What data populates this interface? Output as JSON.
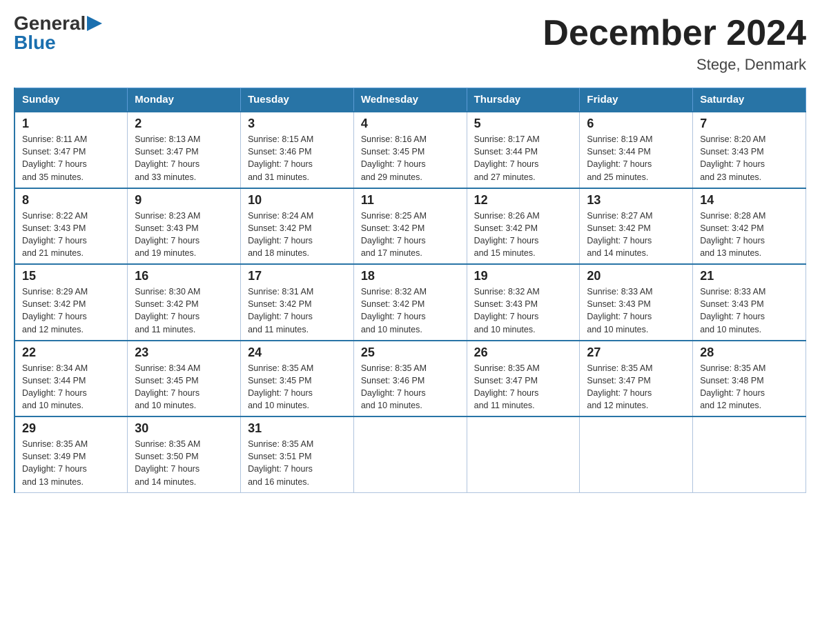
{
  "logo": {
    "general": "General",
    "blue": "Blue",
    "arrow": "▶"
  },
  "title": {
    "month": "December 2024",
    "location": "Stege, Denmark"
  },
  "days_of_week": [
    "Sunday",
    "Monday",
    "Tuesday",
    "Wednesday",
    "Thursday",
    "Friday",
    "Saturday"
  ],
  "weeks": [
    [
      {
        "day": "1",
        "sunrise": "8:11 AM",
        "sunset": "3:47 PM",
        "daylight": "7 hours and 35 minutes."
      },
      {
        "day": "2",
        "sunrise": "8:13 AM",
        "sunset": "3:47 PM",
        "daylight": "7 hours and 33 minutes."
      },
      {
        "day": "3",
        "sunrise": "8:15 AM",
        "sunset": "3:46 PM",
        "daylight": "7 hours and 31 minutes."
      },
      {
        "day": "4",
        "sunrise": "8:16 AM",
        "sunset": "3:45 PM",
        "daylight": "7 hours and 29 minutes."
      },
      {
        "day": "5",
        "sunrise": "8:17 AM",
        "sunset": "3:44 PM",
        "daylight": "7 hours and 27 minutes."
      },
      {
        "day": "6",
        "sunrise": "8:19 AM",
        "sunset": "3:44 PM",
        "daylight": "7 hours and 25 minutes."
      },
      {
        "day": "7",
        "sunrise": "8:20 AM",
        "sunset": "3:43 PM",
        "daylight": "7 hours and 23 minutes."
      }
    ],
    [
      {
        "day": "8",
        "sunrise": "8:22 AM",
        "sunset": "3:43 PM",
        "daylight": "7 hours and 21 minutes."
      },
      {
        "day": "9",
        "sunrise": "8:23 AM",
        "sunset": "3:43 PM",
        "daylight": "7 hours and 19 minutes."
      },
      {
        "day": "10",
        "sunrise": "8:24 AM",
        "sunset": "3:42 PM",
        "daylight": "7 hours and 18 minutes."
      },
      {
        "day": "11",
        "sunrise": "8:25 AM",
        "sunset": "3:42 PM",
        "daylight": "7 hours and 17 minutes."
      },
      {
        "day": "12",
        "sunrise": "8:26 AM",
        "sunset": "3:42 PM",
        "daylight": "7 hours and 15 minutes."
      },
      {
        "day": "13",
        "sunrise": "8:27 AM",
        "sunset": "3:42 PM",
        "daylight": "7 hours and 14 minutes."
      },
      {
        "day": "14",
        "sunrise": "8:28 AM",
        "sunset": "3:42 PM",
        "daylight": "7 hours and 13 minutes."
      }
    ],
    [
      {
        "day": "15",
        "sunrise": "8:29 AM",
        "sunset": "3:42 PM",
        "daylight": "7 hours and 12 minutes."
      },
      {
        "day": "16",
        "sunrise": "8:30 AM",
        "sunset": "3:42 PM",
        "daylight": "7 hours and 11 minutes."
      },
      {
        "day": "17",
        "sunrise": "8:31 AM",
        "sunset": "3:42 PM",
        "daylight": "7 hours and 11 minutes."
      },
      {
        "day": "18",
        "sunrise": "8:32 AM",
        "sunset": "3:42 PM",
        "daylight": "7 hours and 10 minutes."
      },
      {
        "day": "19",
        "sunrise": "8:32 AM",
        "sunset": "3:43 PM",
        "daylight": "7 hours and 10 minutes."
      },
      {
        "day": "20",
        "sunrise": "8:33 AM",
        "sunset": "3:43 PM",
        "daylight": "7 hours and 10 minutes."
      },
      {
        "day": "21",
        "sunrise": "8:33 AM",
        "sunset": "3:43 PM",
        "daylight": "7 hours and 10 minutes."
      }
    ],
    [
      {
        "day": "22",
        "sunrise": "8:34 AM",
        "sunset": "3:44 PM",
        "daylight": "7 hours and 10 minutes."
      },
      {
        "day": "23",
        "sunrise": "8:34 AM",
        "sunset": "3:45 PM",
        "daylight": "7 hours and 10 minutes."
      },
      {
        "day": "24",
        "sunrise": "8:35 AM",
        "sunset": "3:45 PM",
        "daylight": "7 hours and 10 minutes."
      },
      {
        "day": "25",
        "sunrise": "8:35 AM",
        "sunset": "3:46 PM",
        "daylight": "7 hours and 10 minutes."
      },
      {
        "day": "26",
        "sunrise": "8:35 AM",
        "sunset": "3:47 PM",
        "daylight": "7 hours and 11 minutes."
      },
      {
        "day": "27",
        "sunrise": "8:35 AM",
        "sunset": "3:47 PM",
        "daylight": "7 hours and 12 minutes."
      },
      {
        "day": "28",
        "sunrise": "8:35 AM",
        "sunset": "3:48 PM",
        "daylight": "7 hours and 12 minutes."
      }
    ],
    [
      {
        "day": "29",
        "sunrise": "8:35 AM",
        "sunset": "3:49 PM",
        "daylight": "7 hours and 13 minutes."
      },
      {
        "day": "30",
        "sunrise": "8:35 AM",
        "sunset": "3:50 PM",
        "daylight": "7 hours and 14 minutes."
      },
      {
        "day": "31",
        "sunrise": "8:35 AM",
        "sunset": "3:51 PM",
        "daylight": "7 hours and 16 minutes."
      },
      null,
      null,
      null,
      null
    ]
  ],
  "labels": {
    "sunrise": "Sunrise:",
    "sunset": "Sunset:",
    "daylight": "Daylight:"
  }
}
